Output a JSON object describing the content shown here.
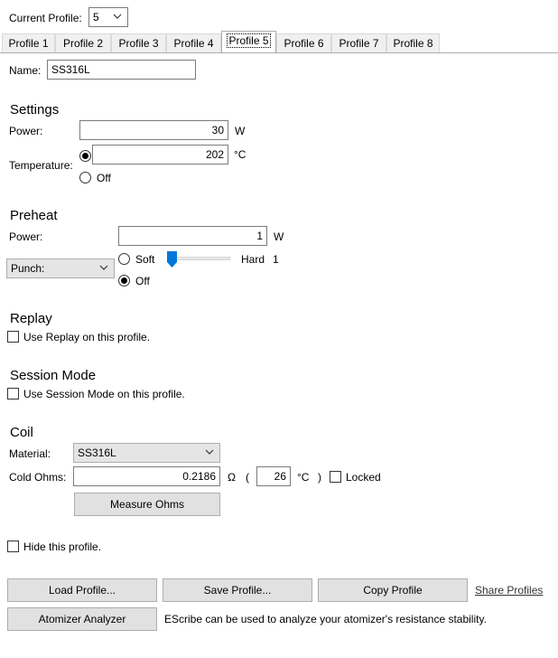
{
  "header": {
    "current_profile_label": "Current Profile:",
    "current_profile_value": "5"
  },
  "tabs": [
    "Profile 1",
    "Profile 2",
    "Profile 3",
    "Profile 4",
    "Profile 5",
    "Profile 6",
    "Profile 7",
    "Profile 8"
  ],
  "active_tab": "Profile 5",
  "name": {
    "label": "Name:",
    "value": "SS316L"
  },
  "settings": {
    "title": "Settings",
    "power_label": "Power:",
    "power_value": "30",
    "power_unit": "W",
    "temperature_label": "Temperature:",
    "temperature_value": "202",
    "temperature_unit": "°C",
    "off_label": "Off",
    "temperature_mode": "temperature"
  },
  "preheat": {
    "title": "Preheat",
    "power_label": "Power:",
    "power_value": "1",
    "power_unit": "W",
    "type_value": "Punch:",
    "soft_label": "Soft",
    "hard_label": "Hard",
    "slider_value": "1",
    "off_label": "Off",
    "mode": "off"
  },
  "replay": {
    "title": "Replay",
    "checkbox_label": "Use Replay on this profile.",
    "checked": false
  },
  "session_mode": {
    "title": "Session Mode",
    "checkbox_label": "Use Session Mode on this profile.",
    "checked": false
  },
  "coil": {
    "title": "Coil",
    "material_label": "Material:",
    "material_value": "SS316L",
    "cold_ohms_label": "Cold Ohms:",
    "cold_ohms_value": "0.2186",
    "ohm_unit": "Ω",
    "paren_open": "(",
    "paren_close": ")",
    "temp_value": "26",
    "temp_unit": "°C",
    "locked_label": "Locked",
    "locked": false,
    "measure_button": "Measure Ohms"
  },
  "hide_profile": {
    "label": "Hide this profile.",
    "checked": false
  },
  "footer": {
    "load_button": "Load Profile...",
    "save_button": "Save Profile...",
    "copy_button": "Copy Profile",
    "share_link": "Share Profiles",
    "analyzer_button": "Atomizer Analyzer",
    "analyzer_text": "EScribe can be used to analyze your atomizer's resistance stability."
  },
  "colors": {
    "slider_accent": "#0078d7",
    "button_bg": "#e1e1e1",
    "combo_bg": "#e5e5e5"
  }
}
